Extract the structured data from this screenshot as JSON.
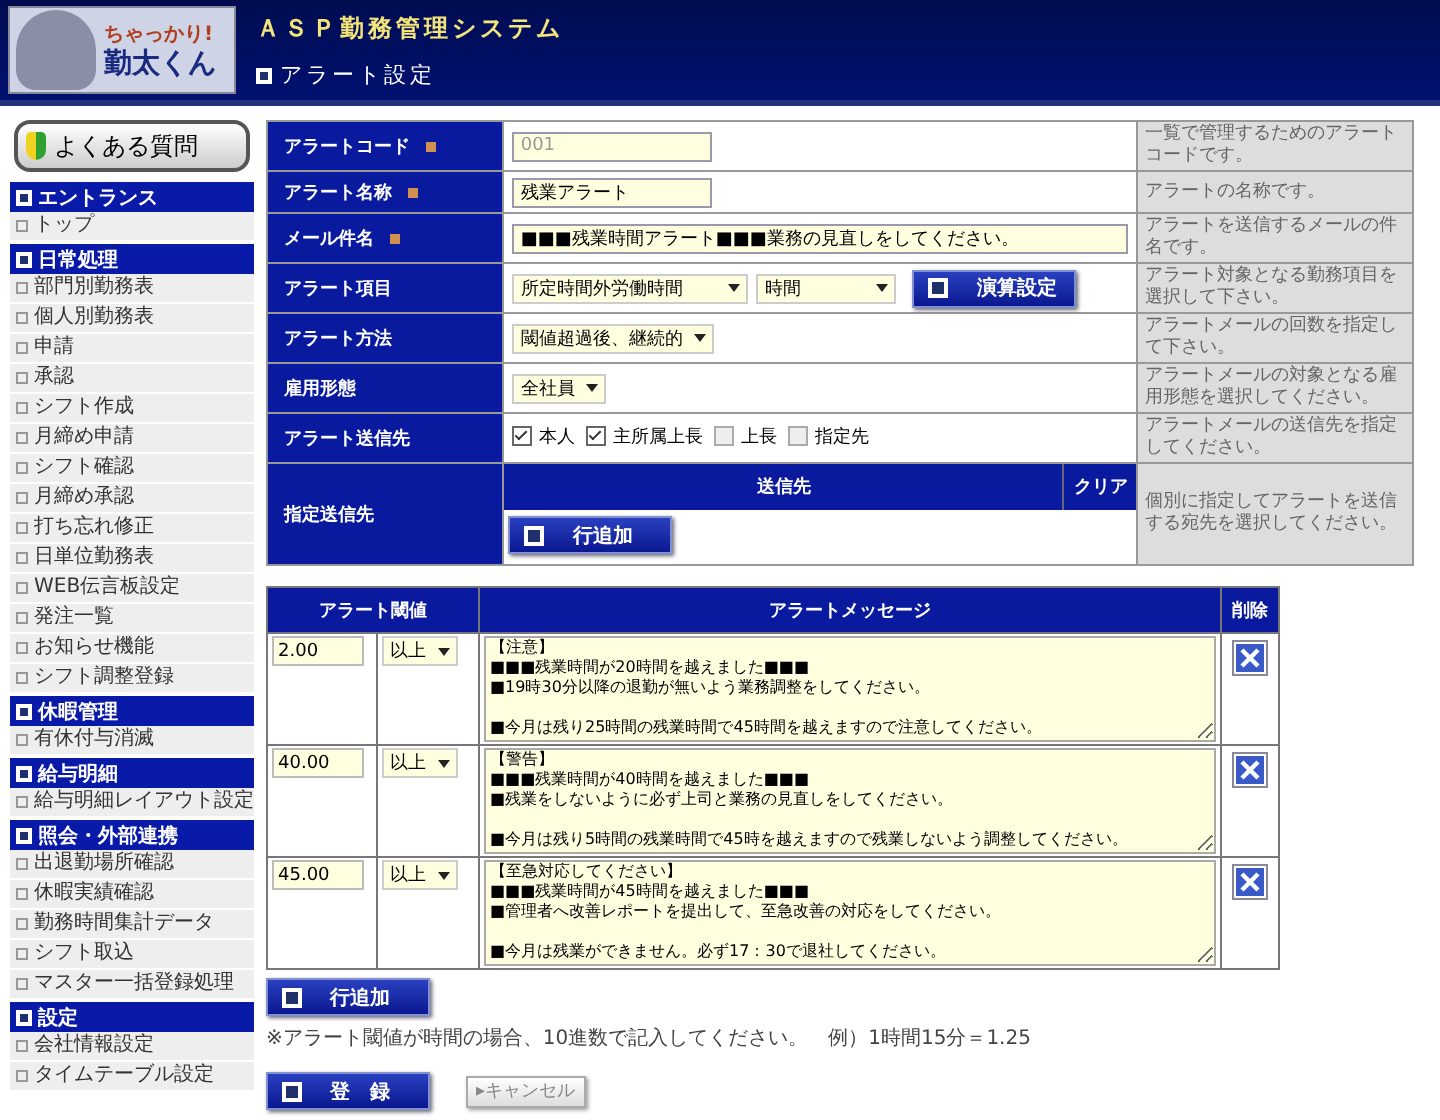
{
  "header": {
    "logo_lines": [
      "ちゃっかり!",
      "勤太くん"
    ],
    "system_title": "ＡＳＰ勤務管理システム",
    "page_title": "アラート設定"
  },
  "sidebar": {
    "faq_button": "よくある質問",
    "sections": [
      {
        "title": "エントランス",
        "items": [
          "トップ"
        ]
      },
      {
        "title": "日常処理",
        "items": [
          "部門別勤務表",
          "個人別勤務表",
          "申請",
          "承認",
          "シフト作成",
          "月締め申請",
          "シフト確認",
          "月締め承認",
          "打ち忘れ修正",
          "日単位勤務表",
          "WEB伝言板設定",
          "発注一覧",
          "お知らせ機能",
          "シフト調整登録"
        ]
      },
      {
        "title": "休暇管理",
        "items": [
          "有休付与消滅"
        ]
      },
      {
        "title": "給与明細",
        "items": [
          "給与明細レイアウト設定"
        ]
      },
      {
        "title": "照会・外部連携",
        "items": [
          "出退勤場所確認",
          "休暇実績確認",
          "勤務時間集計データ",
          "シフト取込",
          "マスター一括登録処理"
        ]
      },
      {
        "title": "設定",
        "items": [
          "会社情報設定",
          "タイムテーブル設定"
        ]
      }
    ]
  },
  "form": {
    "rows": [
      {
        "kind": "text",
        "label": "アラートコード",
        "required": true,
        "value": "001",
        "disabled": true,
        "description": "一覧で管理するためのアラートコードです。"
      },
      {
        "kind": "text",
        "label": "アラート名称",
        "required": true,
        "value": "残業アラート",
        "disabled": false,
        "description": "アラートの名称です。"
      },
      {
        "kind": "wide_text",
        "label": "メール件名",
        "required": true,
        "value": "■■■残業時間アラート■■■業務の見直しをしてください。",
        "disabled": false,
        "description": "アラートを送信するメールの件名です。"
      },
      {
        "kind": "selects",
        "label": "アラート項目",
        "required": false,
        "selects": [
          "所定時間外労働時間",
          "時間"
        ],
        "button": "演算設定",
        "description": "アラート対象となる勤務項目を選択して下さい。"
      },
      {
        "kind": "selects",
        "label": "アラート方法",
        "required": false,
        "selects": [
          "閾値超過後、継続的"
        ],
        "description": "アラートメールの回数を指定して下さい。"
      },
      {
        "kind": "selects",
        "label": "雇用形態",
        "required": false,
        "selects": [
          "全社員"
        ],
        "description": "アラートメールの対象となる雇用形態を選択してください。"
      },
      {
        "kind": "checks",
        "label": "アラート送信先",
        "required": false,
        "checks": [
          {
            "label": "本人",
            "checked": true
          },
          {
            "label": "主所属上長",
            "checked": true
          },
          {
            "label": "上長",
            "checked": false
          },
          {
            "label": "指定先",
            "checked": false
          }
        ],
        "description": "アラートメールの送信先を指定してください。"
      },
      {
        "kind": "recipients",
        "label": "指定送信先",
        "required": false,
        "columns": [
          "送信先",
          "クリア"
        ],
        "button": "行追加",
        "description": "個別に指定してアラートを送信する宛先を選択してください。"
      }
    ]
  },
  "alerts": {
    "columns": [
      "アラート閾値",
      "アラートメッセージ",
      "削除"
    ],
    "rows": [
      {
        "threshold": "2.00",
        "condition": "以上",
        "message": "【注意】\n■■■残業時間が20時間を越えました■■■\n■19時30分以降の退勤が無いよう業務調整をしてください。\n\n■今月は残り25時間の残業時間で45時間を越えますので注意してください。"
      },
      {
        "threshold": "40.00",
        "condition": "以上",
        "message": "【警告】\n■■■残業時間が40時間を越えました■■■\n■残業をしないように必ず上司と業務の見直しをしてください。\n\n■今月は残り5時間の残業時間で45時を越えますので残業しないよう調整してください。"
      },
      {
        "threshold": "45.00",
        "condition": "以上",
        "message": "【至急対応してください】\n■■■残業時間が45時間を越えました■■■\n■管理者へ改善レポートを提出して、至急改善の対応をしてください。\n\n■今月は残業ができません。必ず17：30で退社してください。"
      }
    ],
    "add_button": "行追加",
    "note": "※アラート閾値が時間の場合、10進数で記入してください。　例）1時間15分＝1.25"
  },
  "actions": {
    "submit": "登　録",
    "cancel": "▸キャンセル"
  }
}
